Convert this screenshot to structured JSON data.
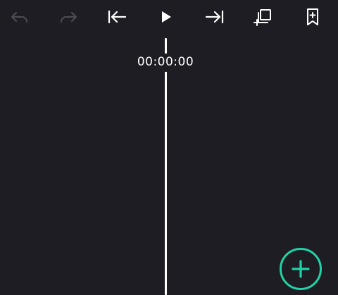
{
  "toolbar": {
    "buttons": [
      {
        "name": "undo",
        "icon": "undo-icon",
        "enabled": false
      },
      {
        "name": "redo",
        "icon": "redo-icon",
        "enabled": false
      },
      {
        "name": "jump-to-start",
        "icon": "skip-to-start-icon",
        "enabled": true
      },
      {
        "name": "play",
        "icon": "play-icon",
        "enabled": true
      },
      {
        "name": "jump-to-end",
        "icon": "skip-to-end-icon",
        "enabled": true
      },
      {
        "name": "duplicate",
        "icon": "duplicate-icon",
        "enabled": true
      },
      {
        "name": "add-marker",
        "icon": "bookmark-add-icon",
        "enabled": true
      }
    ]
  },
  "timeline": {
    "timecode": "00:00:00"
  },
  "fab": {
    "icon": "plus-icon",
    "accent": "#1fd3a6"
  },
  "colors": {
    "background": "#1e1d24",
    "icon_enabled": "#ffffff",
    "icon_disabled": "#4b4a55"
  }
}
